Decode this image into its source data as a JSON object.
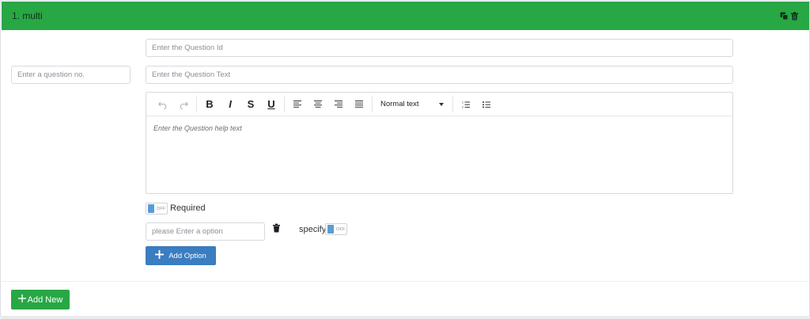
{
  "header": {
    "title": "1. multi",
    "icons": [
      "copy-icon",
      "trash-icon"
    ],
    "bg_color": "#28a745"
  },
  "question": {
    "number_placeholder": "Enter a question no.",
    "id_placeholder": "Enter the Question Id",
    "text_placeholder": "Enter the Question Text"
  },
  "editor": {
    "toolbar": {
      "undo": "undo-icon",
      "redo": "redo-icon",
      "bold": "B",
      "italic": "I",
      "strike": "S",
      "underline": "U",
      "align": [
        "align-left-icon",
        "align-center-icon",
        "align-right-icon",
        "align-justify-icon"
      ],
      "block_format": "Normal text",
      "lists": [
        "ordered-list-icon",
        "bullet-list-icon"
      ]
    },
    "help_placeholder": "Enter the Question help text"
  },
  "required": {
    "label": "Required",
    "toggle_text": "OFF",
    "value": false
  },
  "option": {
    "placeholder": "please Enter a option",
    "specify_label": "specify",
    "specify_toggle_text": "OFF",
    "specify_value": false
  },
  "buttons": {
    "add_option": "Add Option",
    "add_new": "Add New"
  },
  "colors": {
    "primary": "#3a7dc0",
    "success": "#28a745",
    "toggle_knob": "#5b9bd5"
  }
}
